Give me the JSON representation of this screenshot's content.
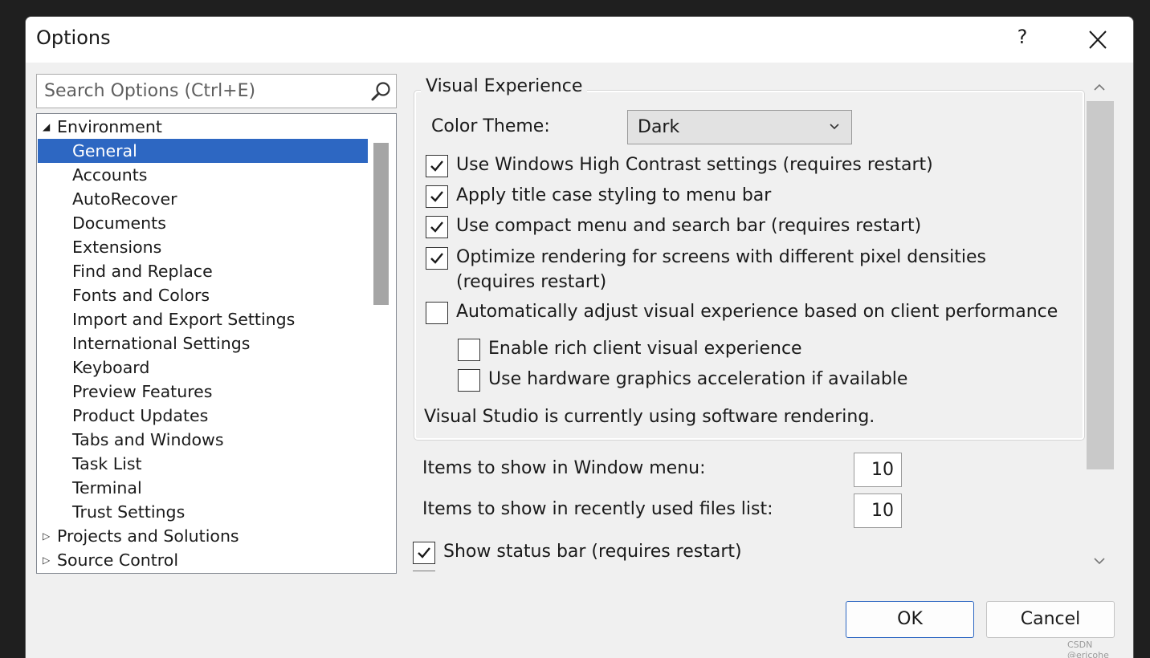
{
  "dialog": {
    "title": "Options",
    "help_label": "?",
    "search": {
      "placeholder": "Search Options (Ctrl+E)",
      "value": ""
    }
  },
  "tree": {
    "items": [
      {
        "label": "Environment",
        "expander": "expanded"
      },
      {
        "label": "General",
        "selected": true
      },
      {
        "label": "Accounts"
      },
      {
        "label": "AutoRecover"
      },
      {
        "label": "Documents"
      },
      {
        "label": "Extensions"
      },
      {
        "label": "Find and Replace"
      },
      {
        "label": "Fonts and Colors"
      },
      {
        "label": "Import and Export Settings"
      },
      {
        "label": "International Settings"
      },
      {
        "label": "Keyboard"
      },
      {
        "label": "Preview Features"
      },
      {
        "label": "Product Updates"
      },
      {
        "label": "Tabs and Windows"
      },
      {
        "label": "Task List"
      },
      {
        "label": "Terminal"
      },
      {
        "label": "Trust Settings"
      },
      {
        "label": "Projects and Solutions",
        "expander": "collapsed"
      },
      {
        "label": "Source Control",
        "expander": "collapsed"
      }
    ]
  },
  "visual_experience": {
    "group_title": "Visual Experience",
    "color_theme_label": "Color Theme:",
    "color_theme_value": "Dark",
    "options": [
      {
        "label": "Use Windows High Contrast settings (requires restart)",
        "checked": true
      },
      {
        "label": "Apply title case styling to menu bar",
        "checked": true
      },
      {
        "label": "Use compact menu and search bar (requires restart)",
        "checked": true
      },
      {
        "label": "Optimize rendering for screens with different pixel densities",
        "label_line2": "(requires restart)",
        "checked": true
      },
      {
        "label": "Automatically adjust visual experience based on client performance",
        "checked": false
      }
    ],
    "sub_options": [
      {
        "label": "Enable rich client visual experience",
        "checked": false
      },
      {
        "label": "Use hardware graphics acceleration if available",
        "checked": false
      }
    ],
    "status": "Visual Studio is currently using software rendering."
  },
  "general": {
    "window_menu_label": "Items to show in Window menu:",
    "window_menu_value": "10",
    "recent_files_label": "Items to show in recently used files list:",
    "recent_files_value": "10",
    "status_bar_label": "Show status bar (requires restart)",
    "status_bar_checked": true
  },
  "buttons": {
    "ok": "OK",
    "cancel": "Cancel"
  },
  "watermark": "CSDN @ericohe",
  "colors": {
    "selection": "#2d67c2",
    "dialog_bg": "#f0f0f0",
    "backdrop": "#1f1f1f"
  }
}
